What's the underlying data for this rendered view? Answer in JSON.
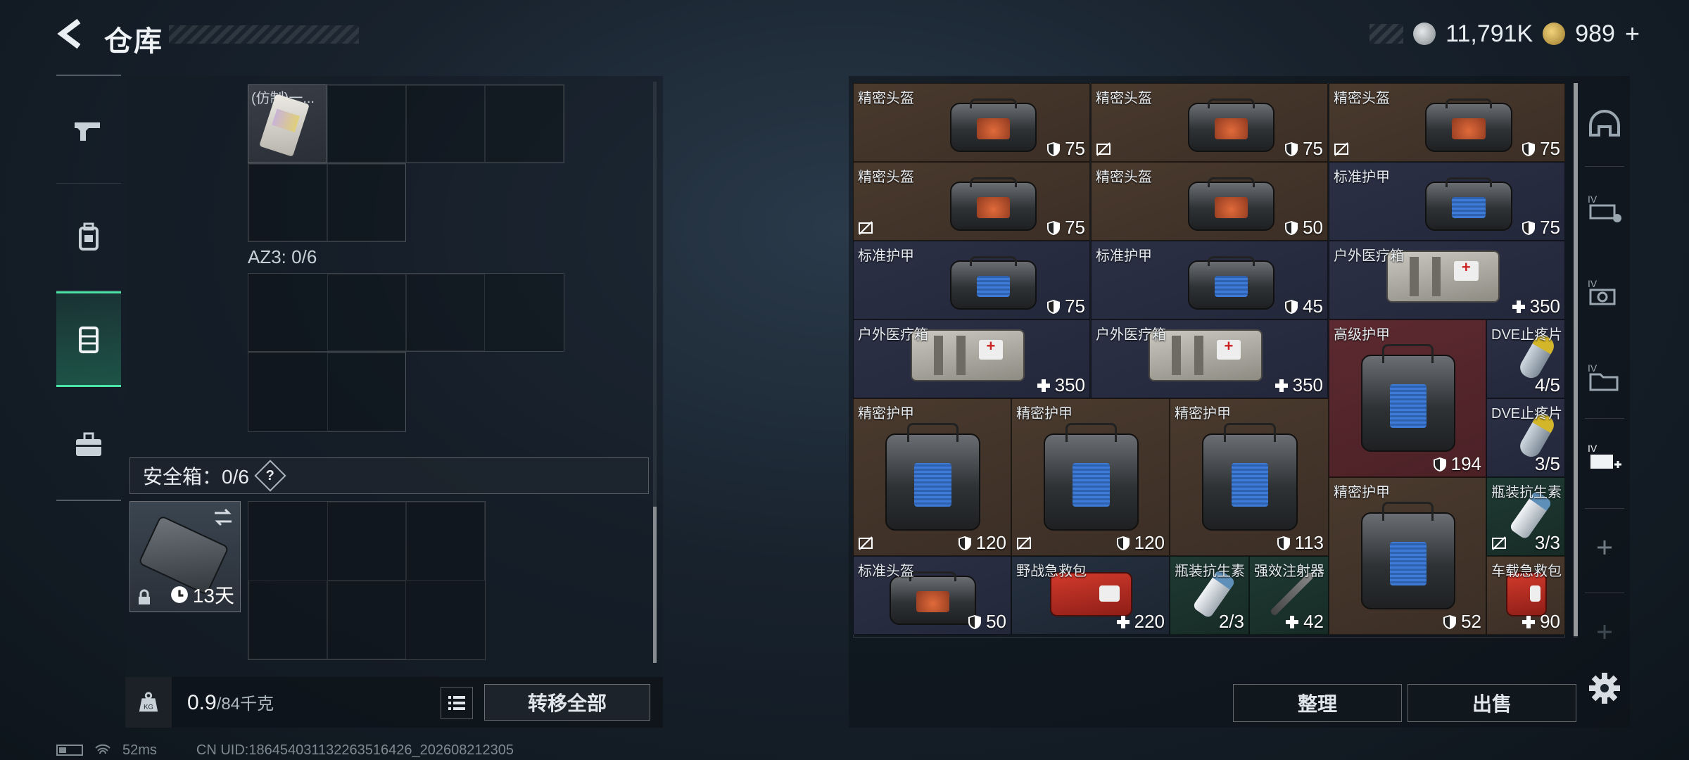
{
  "header": {
    "title": "仓库"
  },
  "currency": {
    "silver": "11,791K",
    "gold": "989",
    "plus": "+"
  },
  "left": {
    "top_item_name": "(仿制)一...",
    "az3_label": "AZ3: 0/6",
    "safe_label": "安全箱：0/6",
    "help": "?",
    "safebox_timer": "13天",
    "weight_value": "0.9",
    "weight_max": "/84千克",
    "weight_icon_text": "KG",
    "transfer_all": "转移全部"
  },
  "status": {
    "ping": "52ms",
    "uid": "CN UID:18645403113226351​6426_202608212305"
  },
  "stash_items": [
    {
      "name": "精密头盔",
      "value": "75",
      "kind": "helmet",
      "color": "brown",
      "nofx": false
    },
    {
      "name": "精密头盔",
      "value": "75",
      "kind": "helmet",
      "color": "brown",
      "nofx": true
    },
    {
      "name": "精密头盔",
      "value": "75",
      "kind": "helmet",
      "color": "brown",
      "nofx": true
    },
    {
      "name": "精密头盔",
      "value": "75",
      "kind": "helmet",
      "color": "brown",
      "nofx": true
    },
    {
      "name": "精密头盔",
      "value": "50",
      "kind": "helmet",
      "color": "brown",
      "nofx": false
    },
    {
      "name": "标准护甲",
      "value": "75",
      "kind": "armor",
      "color": "navy",
      "nofx": false
    },
    {
      "name": "标准护甲",
      "value": "75",
      "kind": "armor",
      "color": "navy",
      "nofx": false
    },
    {
      "name": "标准护甲",
      "value": "45",
      "kind": "armor",
      "color": "navy",
      "nofx": false
    },
    {
      "name": "户外医疗箱",
      "value": "350",
      "kind": "medkit",
      "color": "navy",
      "nofx": false
    },
    {
      "name": "户外医疗箱",
      "value": "350",
      "kind": "medkit",
      "color": "navy",
      "nofx": false
    },
    {
      "name": "户外医疗箱",
      "value": "350",
      "kind": "medkit",
      "color": "navy",
      "nofx": false
    },
    {
      "name": "高级护甲",
      "value": "194",
      "kind": "armor",
      "color": "red",
      "nofx": false
    },
    {
      "name": "DVE止疼片",
      "value": "4/5",
      "kind": "pill",
      "color": "navy",
      "nofx": false
    },
    {
      "name": "DVE止疼片",
      "value": "3/5",
      "kind": "pill",
      "color": "navy",
      "nofx": false
    },
    {
      "name": "精密护甲",
      "value": "120",
      "kind": "armor",
      "color": "brown",
      "nofx": true
    },
    {
      "name": "精密护甲",
      "value": "120",
      "kind": "armor",
      "color": "brown",
      "nofx": true
    },
    {
      "name": "精密护甲",
      "value": "113",
      "kind": "armor",
      "color": "brown",
      "nofx": false
    },
    {
      "name": "精密护甲",
      "value": "52",
      "kind": "armor",
      "color": "brown",
      "nofx": false
    },
    {
      "name": "瓶装抗生素",
      "value": "3/3",
      "kind": "vial",
      "color": "dkgreen",
      "nofx": true
    },
    {
      "name": "标准头盔",
      "value": "50",
      "kind": "helmet",
      "color": "navy",
      "nofx": false
    },
    {
      "name": "野战急救包",
      "value": "220",
      "kind": "redkit",
      "color": "slate",
      "nofx": false
    },
    {
      "name": "瓶装抗生素",
      "value": "2/3",
      "kind": "vial",
      "color": "dkgreen",
      "nofx": false
    },
    {
      "name": "强效注射器",
      "value": "42",
      "kind": "syringe",
      "color": "dkgreen",
      "nofx": false
    },
    {
      "name": "车载急救包",
      "value": "90",
      "kind": "redkit",
      "color": "brown",
      "nofx": false
    }
  ],
  "buttons": {
    "sort": "整理",
    "sell": "出售"
  },
  "icons": {
    "back": "back-arrow-icon",
    "weapon_tab": "pistol-icon",
    "gear_tab": "backpack-icon",
    "storage_tab": "container-icon",
    "case_tab": "briefcase-icon",
    "settings": "gear-icon"
  },
  "colors": {
    "accent": "#4de2a8",
    "brown_rarity": "#4a3a2e",
    "navy_rarity": "#2c3045",
    "red_rarity": "#5c2a30"
  }
}
